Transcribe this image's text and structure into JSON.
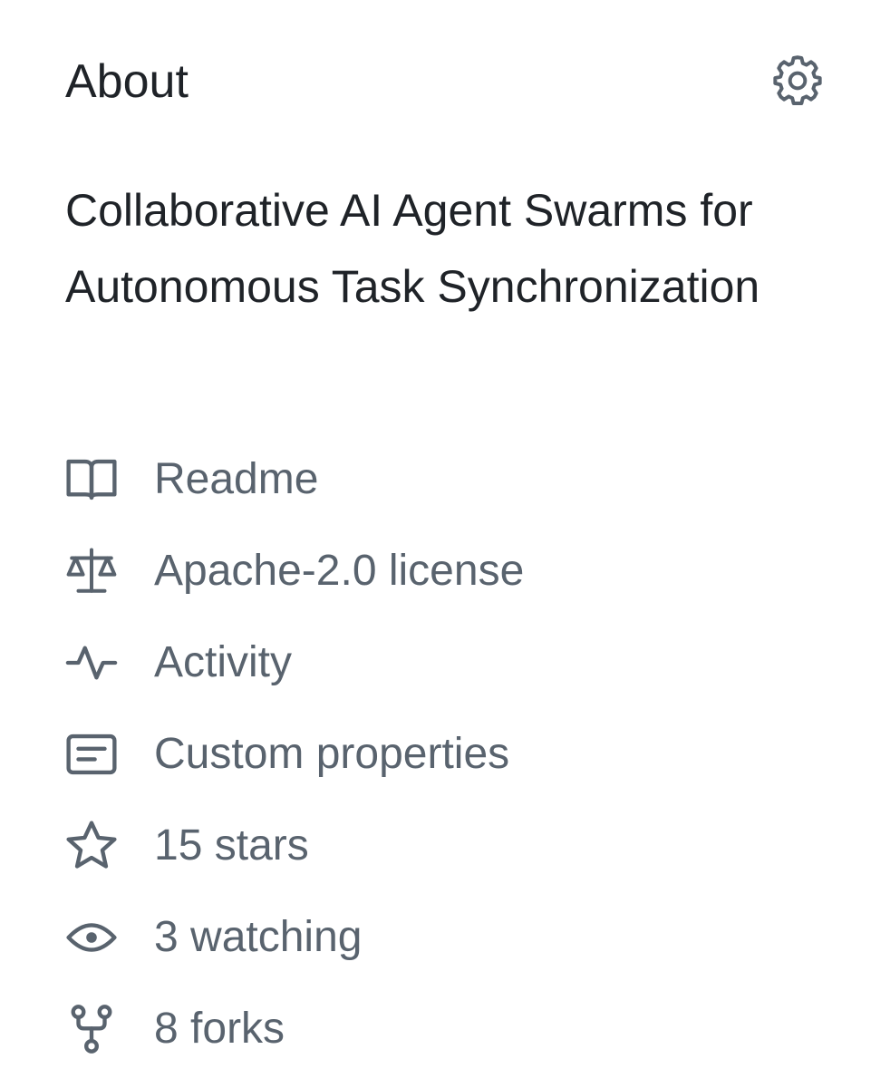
{
  "about": {
    "title": "About",
    "settings_icon": "gear-icon",
    "description": "Collaborative AI Agent Swarms for Autonomous Task Synchronization"
  },
  "meta": {
    "items": [
      {
        "icon": "book-icon",
        "label": "Readme"
      },
      {
        "icon": "law-icon",
        "label": "Apache-2.0 license"
      },
      {
        "icon": "pulse-icon",
        "label": "Activity"
      },
      {
        "icon": "note-icon",
        "label": "Custom properties"
      },
      {
        "icon": "star-icon",
        "label": "15 stars"
      },
      {
        "icon": "eye-icon",
        "label": "3 watching"
      },
      {
        "icon": "repo-forked-icon",
        "label": "8 forks"
      }
    ]
  },
  "colors": {
    "text_primary": "#1f2328",
    "text_muted": "#59636e",
    "background": "#ffffff"
  }
}
